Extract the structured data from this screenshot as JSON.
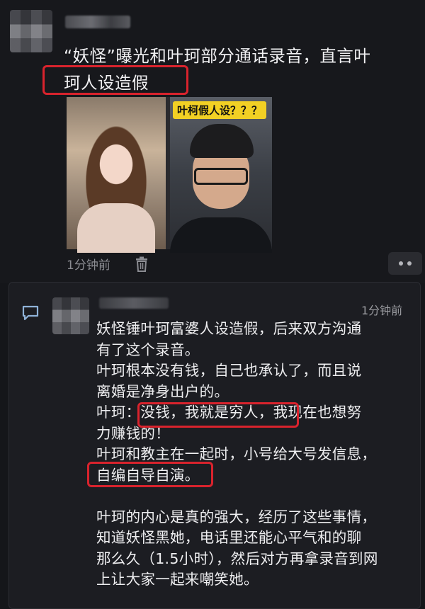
{
  "post": {
    "text_line1": "“妖怪”曝光和叶珂部分通话录音，直言叶",
    "text_line2": "珂人设造假",
    "image_caption": "叶柯假人设？？？",
    "time": "1分钟前",
    "icons": {
      "delete": "trash-icon",
      "more": "more-icon"
    }
  },
  "comment": {
    "time": "1分钟前",
    "icon": "comment-icon",
    "lines": [
      "妖怪锤叶珂富婆人设造假，后来双方沟通",
      "有了这个录音。",
      "叶珂根本没有钱，自己也承认了，而且说",
      "离婚是净身出户的。",
      "叶珂：没钱，我就是穷人，我现在也想努",
      "力赚钱的！",
      "叶珂和教主在一起时，小号给大号发信息，",
      "自编自导自演。",
      "",
      "叶珂的内心是真的强大，经历了这些事情，",
      "知道妖怪黑她，电话里还能心平气和的聊",
      "那么久（1.5小时），然后对方再拿录音到网",
      "上让大家一起来嘲笑她。"
    ]
  },
  "colors": {
    "highlight": "#d9232d",
    "background": "#15161a",
    "caption_bg": "#f2d024"
  }
}
